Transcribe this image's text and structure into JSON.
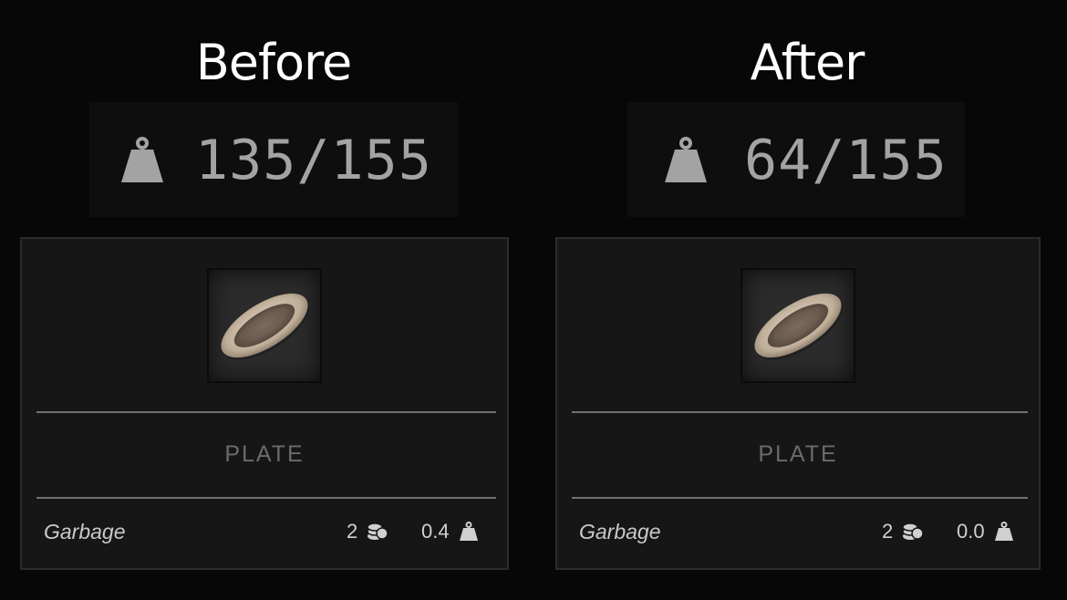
{
  "panels": [
    {
      "heading": "Before",
      "weight": "135/155",
      "item": {
        "name": "PLATE",
        "category": "Garbage",
        "value": "2",
        "weight": "0.4"
      }
    },
    {
      "heading": "After",
      "weight": "64/155",
      "item": {
        "name": "PLATE",
        "category": "Garbage",
        "value": "2",
        "weight": "0.0"
      }
    }
  ],
  "icons": {
    "weight": "weight-icon",
    "coins": "coins-icon",
    "item": "plate-icon"
  },
  "colors": {
    "background": "#070707",
    "card": "#161616",
    "weight_text": "#a3a3a3",
    "item_name": "#6b6b6b"
  }
}
